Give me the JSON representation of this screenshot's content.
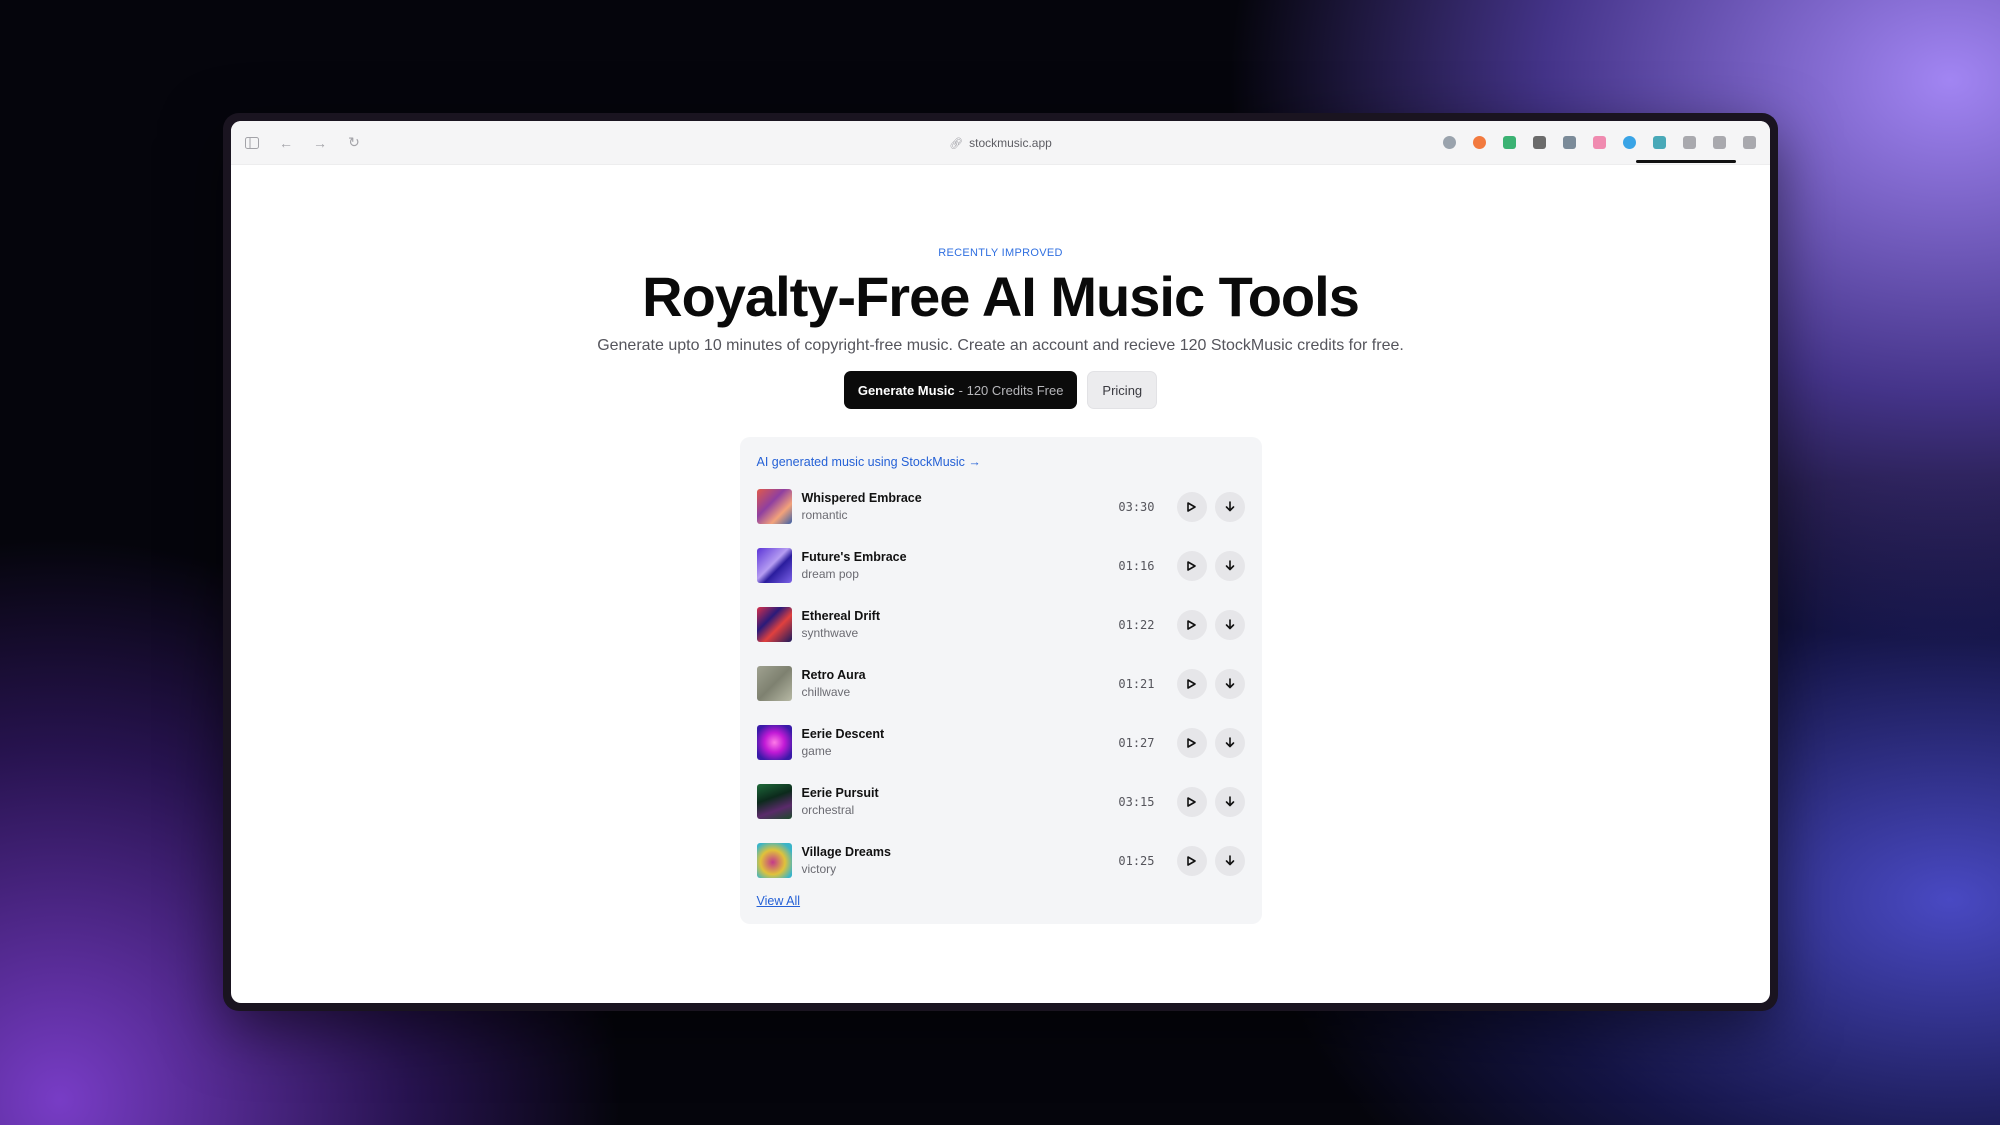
{
  "browser": {
    "url": "stockmusic.app",
    "extensions": [
      {
        "icon": "profile-extension-icon",
        "color": "#9aa3ad",
        "round": true
      },
      {
        "icon": "orange-extension-icon",
        "color": "#f27a3f",
        "round": true
      },
      {
        "icon": "rocket-extension-icon",
        "color": "#3bb273",
        "round": false
      },
      {
        "icon": "notion-extension-icon",
        "color": "#6b6b6b",
        "round": false
      },
      {
        "icon": "image-extension-icon",
        "color": "#7b8b99",
        "round": false
      },
      {
        "icon": "pink-extension-icon",
        "color": "#f08bb0",
        "round": false
      },
      {
        "icon": "blue-circle-extension-icon",
        "color": "#3aa4e6",
        "round": true
      },
      {
        "icon": "teal-extension-icon",
        "color": "#49a9b8",
        "round": false
      },
      {
        "icon": "chat-extension-icon",
        "color": "#a9a9ae",
        "round": false
      },
      {
        "icon": "list-extension-icon",
        "color": "#a9a9ae",
        "round": false
      },
      {
        "icon": "sidebar-extension-icon",
        "color": "#a9a9ae",
        "round": false
      }
    ]
  },
  "hero": {
    "eyebrow": "RECENTLY IMPROVED",
    "title": "Royalty-Free AI Music Tools",
    "subtitle": "Generate upto 10 minutes of copyright-free music. Create an account and recieve 120 StockMusic credits for free.",
    "primary_label": "Generate Music",
    "primary_suffix": "- 120 Credits Free",
    "secondary_label": "Pricing"
  },
  "panel": {
    "link_text": "AI generated music using StockMusic →",
    "view_all": "View All",
    "tracks": [
      {
        "title": "Whispered Embrace",
        "genre": "romantic",
        "duration": "03:30",
        "cover": "linear-gradient(135deg,#e05a4a,#8f3fa0 40%,#f3a27a 70%,#3a5fa8)"
      },
      {
        "title": "Future's Embrace",
        "genre": "dream pop",
        "duration": "01:16",
        "cover": "linear-gradient(135deg,#5a34d6,#b59cf2 45%,#2a1c9e 60%,#7d63e8)"
      },
      {
        "title": "Ethereal Drift",
        "genre": "synthwave",
        "duration": "01:22",
        "cover": "linear-gradient(135deg,#d8304a,#2a1a7a 35%,#e0403e 60%,#1b1a5e)"
      },
      {
        "title": "Retro Aura",
        "genre": "chillwave",
        "duration": "01:21",
        "cover": "linear-gradient(135deg,#9fa190,#7e8170 50%,#b7b9a5)"
      },
      {
        "title": "Eerie Descent",
        "genre": "game",
        "duration": "01:27",
        "cover": "radial-gradient(circle at 50% 50%,#ff7ae8,#c21ad6 40%,#3a1aa8 80%)"
      },
      {
        "title": "Eerie Pursuit",
        "genre": "orchestral",
        "duration": "03:15",
        "cover": "linear-gradient(160deg,#1e6a3a,#0c2a1c 40%,#5a2a6a 70%,#1c4a2a)"
      },
      {
        "title": "Village Dreams",
        "genre": "victory",
        "duration": "01:25",
        "cover": "radial-gradient(circle at 45% 55%,#c43a8a,#e0c23a 45%,#3ab4c8 80%)"
      }
    ]
  }
}
